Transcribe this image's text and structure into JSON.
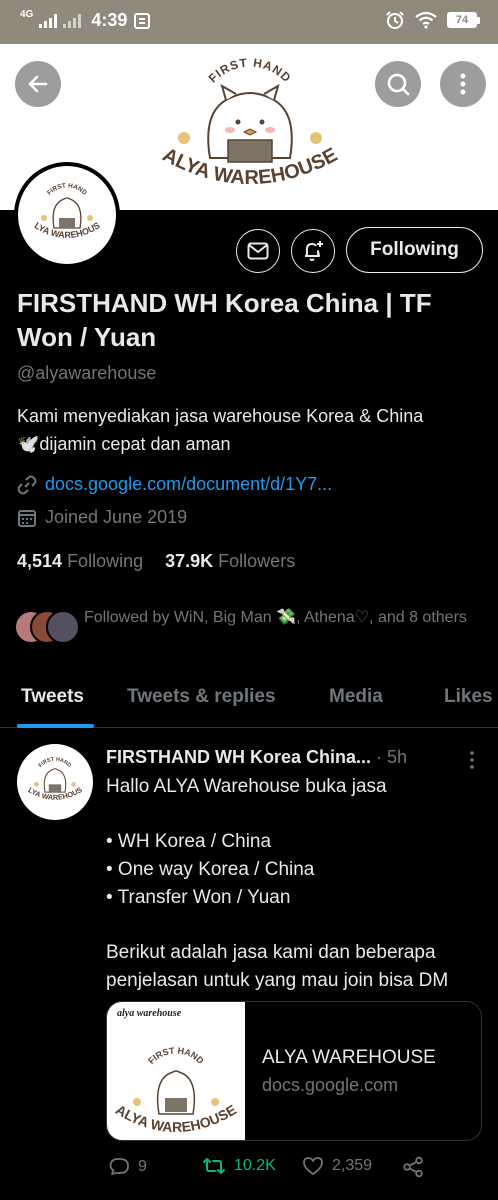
{
  "status_bar": {
    "network": "4G",
    "time": "4:39",
    "battery": "74"
  },
  "banner": {
    "logo_top_text": "FIRST HAND",
    "logo_bottom_text": "ALYA WAREHOUSE"
  },
  "profile": {
    "avatar_top_text": "FIRST HAND",
    "avatar_bottom_text": "ALYA WAREHOUSE",
    "follow_label": "Following",
    "display_name": "FIRSTHAND WH Korea China | TF Won / Yuan",
    "handle": "@alyawarehouse",
    "bio_line1": "Kami menyediakan jasa warehouse Korea & China",
    "bio_line2": "🕊️dijamin cepat dan aman",
    "link": "docs.google.com/document/d/1Y7...",
    "joined": "Joined June 2019",
    "following_count": "4,514",
    "following_label": "Following",
    "followers_count": "37.9K",
    "followers_label": "Followers",
    "followed_by": "Followed by WiN, Big Man 💸, Athena♡, and 8 others"
  },
  "tabs": [
    "Tweets",
    "Tweets & replies",
    "Media",
    "Likes"
  ],
  "tweet": {
    "avatar_top_text": "FIRST HAND",
    "avatar_bottom_text": "ALYA WAREHOUSE",
    "author": "FIRSTHAND WH Korea China...",
    "time": "5h",
    "line1": "Hallo ALYA Warehouse buka jasa",
    "bullet1": "• WH Korea / China",
    "bullet2": "• One way Korea / China",
    "bullet3": "• Transfer Won / Yuan",
    "line2": "Berikut adalah jasa kami dan beberapa",
    "line3": "penjelasan untuk yang mau join bisa DM",
    "card": {
      "img_caption": "alya warehouse",
      "img_top_text": "FIRST HAND",
      "img_bottom_text": "ALYA WAREHOUSE",
      "title": "ALYA WAREHOUSE",
      "domain": "docs.google.com"
    },
    "replies": "9",
    "retweets": "10.2K",
    "likes": "2,359"
  },
  "colors": {
    "accent": "#1d9bf0",
    "retweet": "#00ba7c",
    "status_bar": "#8f8a7b",
    "logo_brown": "#5a4230"
  },
  "icons": [
    "back-arrow-icon",
    "search-icon",
    "more-vertical-icon",
    "mail-icon",
    "bell-plus-icon",
    "link-icon",
    "calendar-icon",
    "more-icon",
    "reply-icon",
    "retweet-icon",
    "like-icon",
    "share-icon"
  ]
}
